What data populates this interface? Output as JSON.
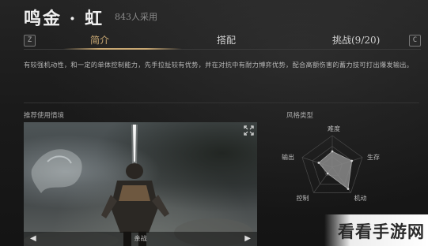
{
  "header": {
    "title": "鸣金 · 虹",
    "usage_count": "843人采用"
  },
  "tabs": {
    "left_key": "Z",
    "right_key": "C",
    "items": [
      {
        "label": "简介",
        "active": true
      },
      {
        "label": "搭配",
        "active": false
      },
      {
        "label": "挑战(9/20)",
        "active": false
      }
    ]
  },
  "description": "有较强机动性，和一定的单体控制能力，先手拉扯较有优势，并在对抗中有耐力博弈优势，配合高额伤害的蓄力技可打出爆发输出。",
  "video": {
    "section_label": "推荐使用情境",
    "caption": "亲战"
  },
  "style_chart": {
    "section_label": "风格类型"
  },
  "chart_data": {
    "type": "radar",
    "axes": [
      "难度",
      "生存",
      "机动",
      "控制",
      "输出"
    ],
    "values": [
      0.5,
      0.65,
      0.85,
      0.25,
      0.45
    ],
    "max": 1,
    "fill_color": "#8a8a8a"
  },
  "watermark": {
    "text": "看看手游网"
  },
  "colors": {
    "accent": "#c9a873",
    "background": "#1b1b1b"
  }
}
